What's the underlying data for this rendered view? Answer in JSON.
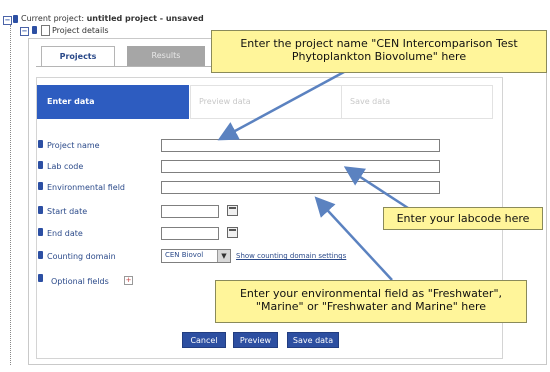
{
  "tree": {
    "project_prefix": "Current project: ",
    "project_name": "untitled project - unsaved",
    "details_label": "Project details"
  },
  "tabs": [
    {
      "label": "Projects",
      "active": true
    },
    {
      "label": "Results",
      "active": false
    }
  ],
  "wizard": {
    "steps": [
      {
        "label": "Enter data",
        "active": true
      },
      {
        "label": "Preview data",
        "active": false
      },
      {
        "label": "Save data",
        "active": false
      }
    ]
  },
  "form": {
    "project_name_label": "Project name",
    "lab_code_label": "Lab code",
    "environmental_field_label": "Environmental field",
    "start_date_label": "Start date",
    "end_date_label": "End date",
    "counting_domain_label": "Counting domain",
    "counting_domain_value": "CEN Biovol",
    "counting_domain_link": "Show counting domain settings",
    "optional_fields_label": "Optional fields"
  },
  "buttons": {
    "cancel": "Cancel",
    "preview": "Preview",
    "save": "Save data"
  },
  "callouts": {
    "project_name_line1": "Enter the project name \"CEN Intercomparison Test",
    "project_name_line2": "Phytoplankton Biovolume\" here",
    "labcode": "Enter your labcode here",
    "environmental_line1": "Enter your environmental field as \"Freshwater\",",
    "environmental_line2": "\"Marine\" or \"Freshwater and Marine\" here"
  },
  "colors": {
    "accent": "#2d4fa1",
    "callout_bg": "#fff59a",
    "arrow": "#5b82c0"
  },
  "icons": [
    "tree-expand-icon",
    "info-icon",
    "calendar-icon",
    "dropdown-arrow-icon",
    "plus-icon",
    "arrow-icon"
  ]
}
